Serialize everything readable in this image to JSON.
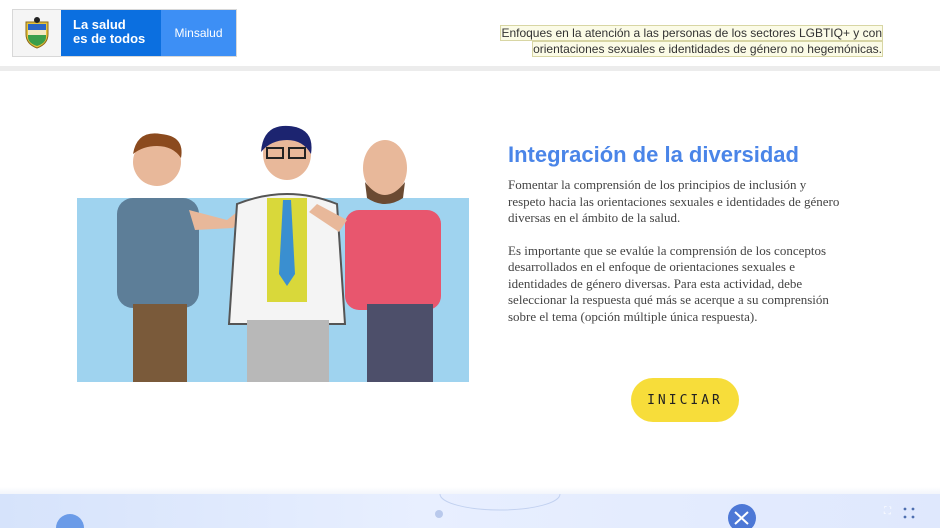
{
  "header": {
    "logo_line1": "La salud",
    "logo_line2": "es de todos",
    "logo_ministry": "Minsalud",
    "course_title_line1": "Enfoques en la atención a las personas de los sectores LGBTIQ+ y con",
    "course_title_line2": "orientaciones sexuales e identidades de género no hegemónicas."
  },
  "main": {
    "title": "Integración de la diversidad",
    "paragraph1": "Fomentar la comprensión de los principios de inclusión y respeto hacia las orientaciones sexuales e identidades de género diversas en el ámbito de la salud.",
    "paragraph2": "Es importante que se evalúe la comprensión de los conceptos desarrollados en el enfoque de orientaciones sexuales e identidades de género diversas. Para esta actividad, debe seleccionar la respuesta qué más se acerque a su comprensión sobre el tema (opción múltiple única respuesta).",
    "start_label": "INICIAR"
  },
  "colors": {
    "brand_blue": "#0b6fe0",
    "title_blue": "#4a85e8",
    "button_yellow": "#f7dd3a",
    "illustration_bg": "#9fd3ef"
  },
  "icons": {
    "logo_shield": "colombia-coat-of-arms-icon",
    "fullscreen": "fullscreen-icon",
    "menu_dots": "dots-grid-icon"
  }
}
